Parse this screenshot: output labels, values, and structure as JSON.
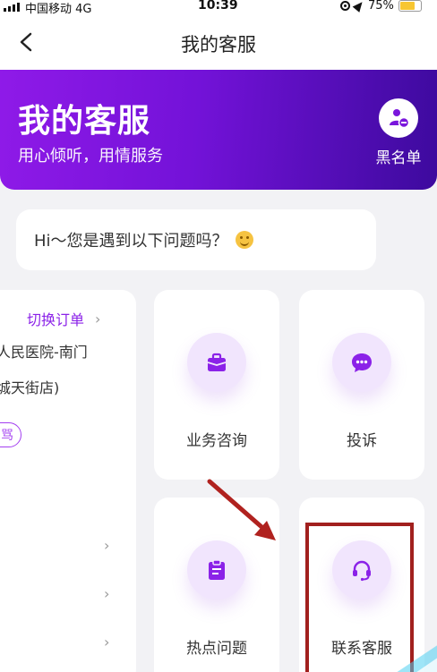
{
  "status_bar": {
    "carrier": "中国移动",
    "network": "4G",
    "time": "10:39",
    "battery": "75%",
    "battery_level": 0.75
  },
  "nav": {
    "title": "我的客服",
    "back_icon": "chevron-left-icon"
  },
  "hero": {
    "title": "我的客服",
    "subtitle": "用心倾听，用情服务",
    "blacklist_label": "黑名单",
    "blacklist_icon": "user-block-icon",
    "gradient_start": "#8f1ae8",
    "gradient_end": "#3d0a9e"
  },
  "greeting": {
    "text": "Hi～您是遇到以下问题吗？",
    "emoji_icon": "smiley-icon"
  },
  "order_card": {
    "switch_label": "切换订单",
    "line1": "人民医院-南门",
    "line2": "城天街店)",
    "tag_text": "骂"
  },
  "tiles": [
    {
      "label": "业务咨询",
      "icon": "briefcase-icon"
    },
    {
      "label": "投诉",
      "icon": "chat-bubble-icon"
    },
    {
      "label": "热点问题",
      "icon": "clipboard-icon"
    },
    {
      "label": "联系客服",
      "icon": "headset-icon"
    }
  ],
  "colors": {
    "accent": "#8b22e8",
    "icon_bg": "#f1e5fd",
    "page_bg": "#f2f2f5",
    "annotation": "#a1201e"
  }
}
